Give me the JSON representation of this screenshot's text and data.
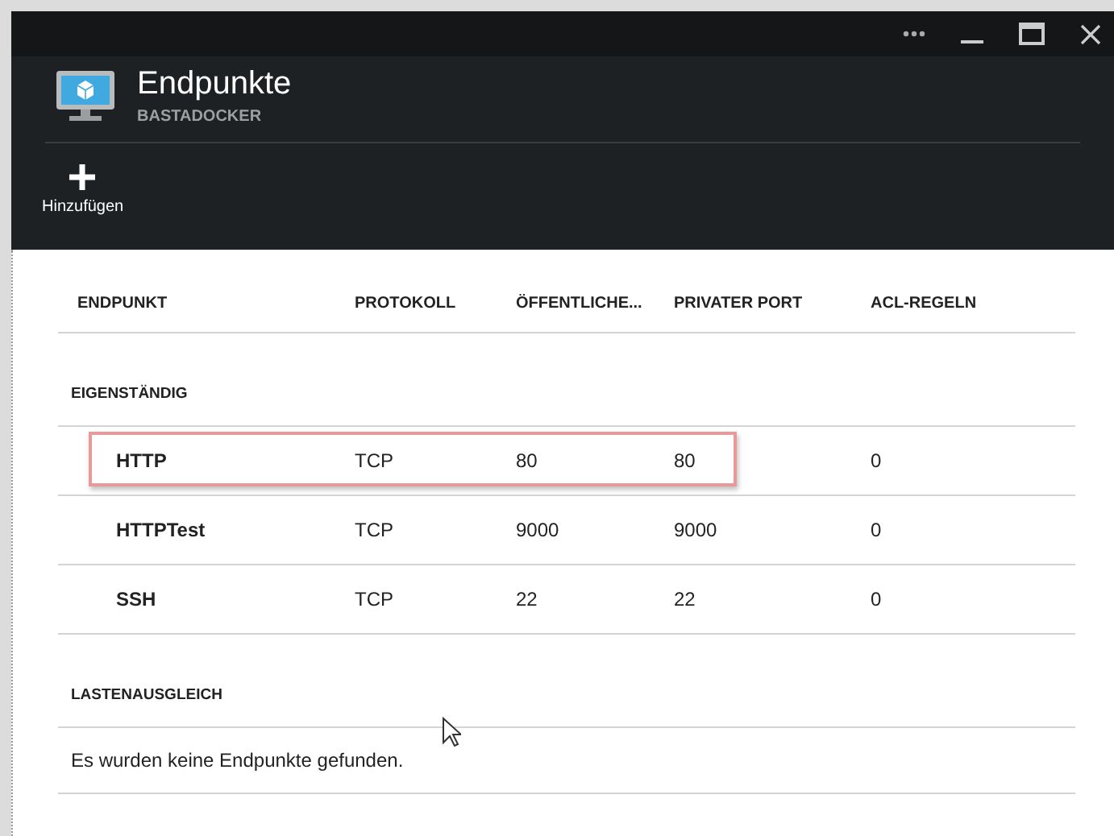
{
  "window": {
    "title": "Endpunkte",
    "subtitle": "BASTADOCKER"
  },
  "toolbar": [
    {
      "label": "Hinzufügen"
    }
  ],
  "table": {
    "columns": [
      "ENDPUNKT",
      "PROTOKOLL",
      "ÖFFENTLICHE...",
      "PRIVATER PORT",
      "ACL-REGELN"
    ],
    "groups": [
      {
        "title": "EIGENSTÄNDIG",
        "rows": [
          {
            "cells": [
              "HTTP",
              "TCP",
              "80",
              "80",
              "0"
            ],
            "highlighted": true
          },
          {
            "cells": [
              "HTTPTest",
              "TCP",
              "9000",
              "9000",
              "0"
            ],
            "highlighted": false
          },
          {
            "cells": [
              "SSH",
              "TCP",
              "22",
              "22",
              "0"
            ],
            "highlighted": false
          }
        ]
      },
      {
        "title": "LASTENAUSGLEICH",
        "empty_message": "Es wurden keine Endpunkte gefunden."
      }
    ]
  }
}
